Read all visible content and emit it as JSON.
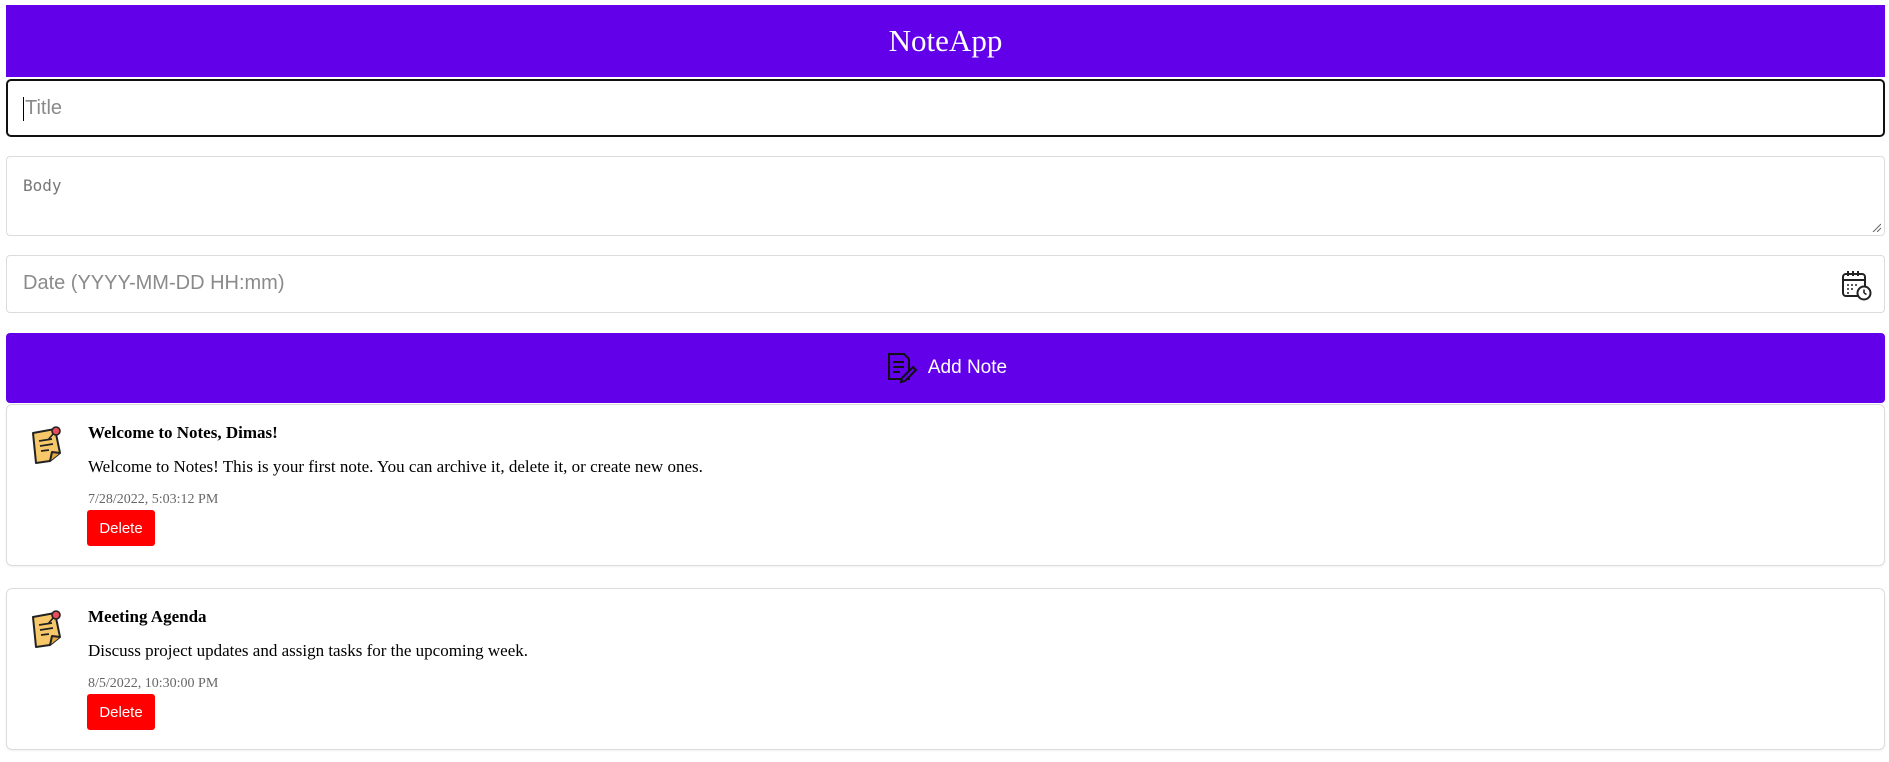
{
  "app": {
    "title": "NoteApp",
    "brand_color": "#6200ea"
  },
  "form": {
    "title_placeholder": "Title",
    "title_value": "",
    "body_placeholder": "Body",
    "body_value": "",
    "date_placeholder": "Date (YYYY-MM-DD HH:mm)",
    "date_value": "",
    "date_icon": "calendar-clock-icon",
    "add_button_label": "Add Note",
    "add_button_icon": "note-edit-icon"
  },
  "notes": [
    {
      "icon": "sticky-note-icon",
      "title": "Welcome to Notes, Dimas!",
      "body": "Welcome to Notes! This is your first note. You can archive it, delete it, or create new ones.",
      "date": "7/28/2022, 5:03:12 PM",
      "delete_label": "Delete"
    },
    {
      "icon": "sticky-note-icon",
      "title": "Meeting Agenda",
      "body": "Discuss project updates and assign tasks for the upcoming week.",
      "date": "8/5/2022, 10:30:00 PM",
      "delete_label": "Delete"
    }
  ],
  "colors": {
    "delete_button": "#ff0000"
  }
}
